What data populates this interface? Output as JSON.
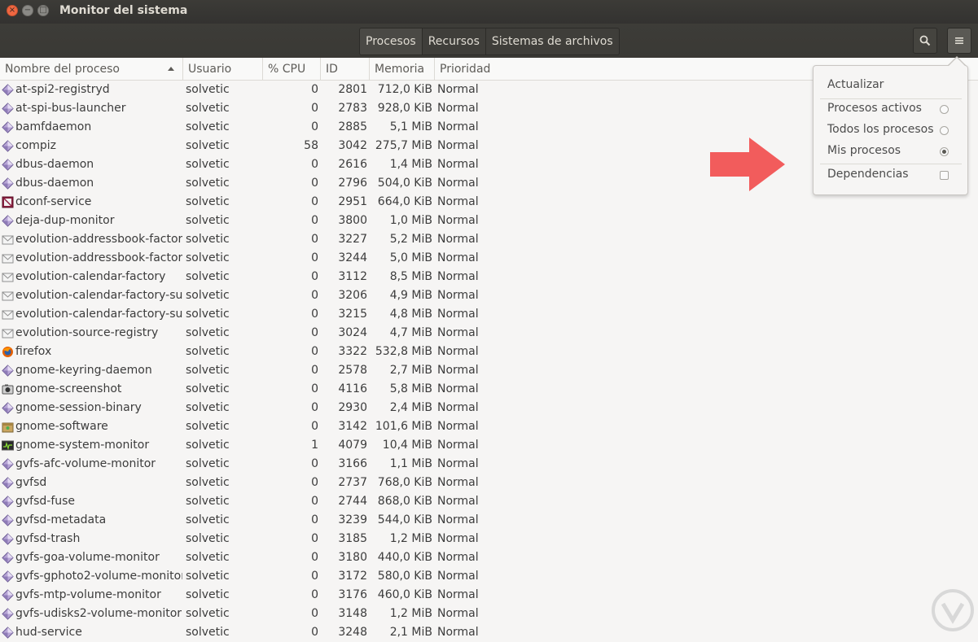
{
  "window": {
    "title": "Monitor del sistema"
  },
  "header": {
    "tabs": [
      {
        "label": "Procesos",
        "active": true
      },
      {
        "label": "Recursos",
        "active": false
      },
      {
        "label": "Sistemas de archivos",
        "active": false
      }
    ],
    "search_icon": "search-icon",
    "menu_icon": "hamburger-menu-icon"
  },
  "columns": {
    "name": "Nombre del proceso",
    "user": "Usuario",
    "cpu": "% CPU",
    "id": "ID",
    "memory": "Memoria",
    "priority": "Prioridad"
  },
  "processes": [
    {
      "name": "at-spi2-registryd",
      "user": "solvetic",
      "cpu": "0",
      "id": "2801",
      "memory": "712,0 KiB",
      "priority": "Normal",
      "icon": "generic"
    },
    {
      "name": "at-spi-bus-launcher",
      "user": "solvetic",
      "cpu": "0",
      "id": "2783",
      "memory": "928,0 KiB",
      "priority": "Normal",
      "icon": "generic"
    },
    {
      "name": "bamfdaemon",
      "user": "solvetic",
      "cpu": "0",
      "id": "2885",
      "memory": "5,1 MiB",
      "priority": "Normal",
      "icon": "generic"
    },
    {
      "name": "compiz",
      "user": "solvetic",
      "cpu": "58",
      "id": "3042",
      "memory": "275,7 MiB",
      "priority": "Normal",
      "icon": "generic"
    },
    {
      "name": "dbus-daemon",
      "user": "solvetic",
      "cpu": "0",
      "id": "2616",
      "memory": "1,4 MiB",
      "priority": "Normal",
      "icon": "generic"
    },
    {
      "name": "dbus-daemon",
      "user": "solvetic",
      "cpu": "0",
      "id": "2796",
      "memory": "504,0 KiB",
      "priority": "Normal",
      "icon": "generic"
    },
    {
      "name": "dconf-service",
      "user": "solvetic",
      "cpu": "0",
      "id": "2951",
      "memory": "664,0 KiB",
      "priority": "Normal",
      "icon": "dconf"
    },
    {
      "name": "deja-dup-monitor",
      "user": "solvetic",
      "cpu": "0",
      "id": "3800",
      "memory": "1,0 MiB",
      "priority": "Normal",
      "icon": "generic"
    },
    {
      "name": "evolution-addressbook-factor",
      "user": "solvetic",
      "cpu": "0",
      "id": "3227",
      "memory": "5,2 MiB",
      "priority": "Normal",
      "icon": "envelope"
    },
    {
      "name": "evolution-addressbook-factor",
      "user": "solvetic",
      "cpu": "0",
      "id": "3244",
      "memory": "5,0 MiB",
      "priority": "Normal",
      "icon": "envelope"
    },
    {
      "name": "evolution-calendar-factory",
      "user": "solvetic",
      "cpu": "0",
      "id": "3112",
      "memory": "8,5 MiB",
      "priority": "Normal",
      "icon": "envelope"
    },
    {
      "name": "evolution-calendar-factory-sul",
      "user": "solvetic",
      "cpu": "0",
      "id": "3206",
      "memory": "4,9 MiB",
      "priority": "Normal",
      "icon": "envelope"
    },
    {
      "name": "evolution-calendar-factory-sul",
      "user": "solvetic",
      "cpu": "0",
      "id": "3215",
      "memory": "4,8 MiB",
      "priority": "Normal",
      "icon": "envelope"
    },
    {
      "name": "evolution-source-registry",
      "user": "solvetic",
      "cpu": "0",
      "id": "3024",
      "memory": "4,7 MiB",
      "priority": "Normal",
      "icon": "envelope"
    },
    {
      "name": "firefox",
      "user": "solvetic",
      "cpu": "0",
      "id": "3322",
      "memory": "532,8 MiB",
      "priority": "Normal",
      "icon": "firefox"
    },
    {
      "name": "gnome-keyring-daemon",
      "user": "solvetic",
      "cpu": "0",
      "id": "2578",
      "memory": "2,7 MiB",
      "priority": "Normal",
      "icon": "generic"
    },
    {
      "name": "gnome-screenshot",
      "user": "solvetic",
      "cpu": "0",
      "id": "4116",
      "memory": "5,8 MiB",
      "priority": "Normal",
      "icon": "camera"
    },
    {
      "name": "gnome-session-binary",
      "user": "solvetic",
      "cpu": "0",
      "id": "2930",
      "memory": "2,4 MiB",
      "priority": "Normal",
      "icon": "generic"
    },
    {
      "name": "gnome-software",
      "user": "solvetic",
      "cpu": "0",
      "id": "3142",
      "memory": "101,6 MiB",
      "priority": "Normal",
      "icon": "software"
    },
    {
      "name": "gnome-system-monitor",
      "user": "solvetic",
      "cpu": "1",
      "id": "4079",
      "memory": "10,4 MiB",
      "priority": "Normal",
      "icon": "monitor"
    },
    {
      "name": "gvfs-afc-volume-monitor",
      "user": "solvetic",
      "cpu": "0",
      "id": "3166",
      "memory": "1,1 MiB",
      "priority": "Normal",
      "icon": "generic"
    },
    {
      "name": "gvfsd",
      "user": "solvetic",
      "cpu": "0",
      "id": "2737",
      "memory": "768,0 KiB",
      "priority": "Normal",
      "icon": "generic"
    },
    {
      "name": "gvfsd-fuse",
      "user": "solvetic",
      "cpu": "0",
      "id": "2744",
      "memory": "868,0 KiB",
      "priority": "Normal",
      "icon": "generic"
    },
    {
      "name": "gvfsd-metadata",
      "user": "solvetic",
      "cpu": "0",
      "id": "3239",
      "memory": "544,0 KiB",
      "priority": "Normal",
      "icon": "generic"
    },
    {
      "name": "gvfsd-trash",
      "user": "solvetic",
      "cpu": "0",
      "id": "3185",
      "memory": "1,2 MiB",
      "priority": "Normal",
      "icon": "generic"
    },
    {
      "name": "gvfs-goa-volume-monitor",
      "user": "solvetic",
      "cpu": "0",
      "id": "3180",
      "memory": "440,0 KiB",
      "priority": "Normal",
      "icon": "generic"
    },
    {
      "name": "gvfs-gphoto2-volume-monitor",
      "user": "solvetic",
      "cpu": "0",
      "id": "3172",
      "memory": "580,0 KiB",
      "priority": "Normal",
      "icon": "generic"
    },
    {
      "name": "gvfs-mtp-volume-monitor",
      "user": "solvetic",
      "cpu": "0",
      "id": "3176",
      "memory": "460,0 KiB",
      "priority": "Normal",
      "icon": "generic"
    },
    {
      "name": "gvfs-udisks2-volume-monitor",
      "user": "solvetic",
      "cpu": "0",
      "id": "3148",
      "memory": "1,2 MiB",
      "priority": "Normal",
      "icon": "generic"
    },
    {
      "name": "hud-service",
      "user": "solvetic",
      "cpu": "0",
      "id": "3248",
      "memory": "2,1 MiB",
      "priority": "Normal",
      "icon": "generic"
    }
  ],
  "menu": {
    "refresh": "Actualizar",
    "active_processes": "Procesos activos",
    "all_processes": "Todos los procesos",
    "my_processes": "Mis procesos",
    "dependencies": "Dependencias",
    "selected": "my_processes",
    "dependencies_checked": false
  },
  "colors": {
    "titlebar": "#3c3b37",
    "close_button": "#f06741",
    "arrow": "#f25c5c",
    "text": "#3c3c3c"
  }
}
